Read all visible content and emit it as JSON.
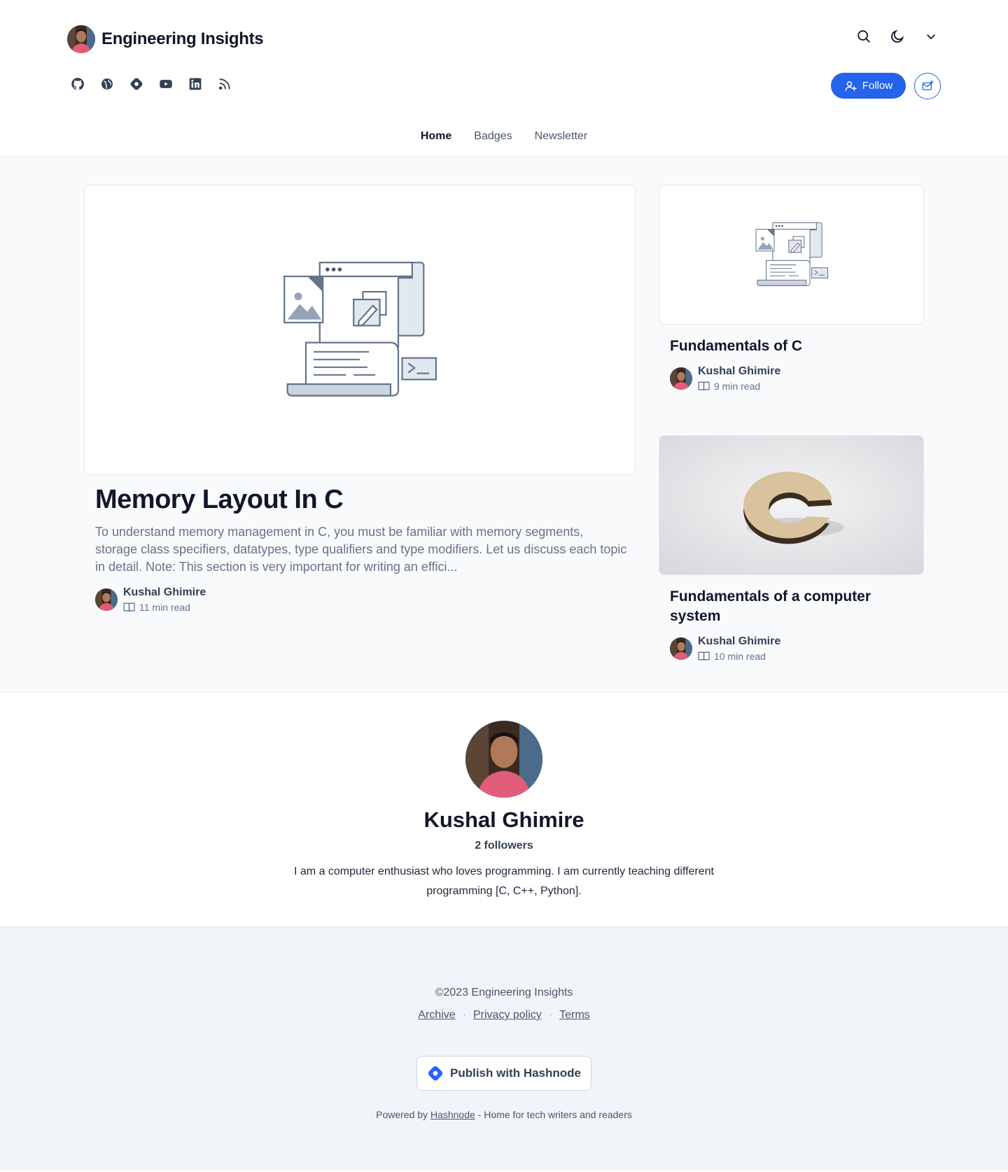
{
  "header": {
    "blog_title": "Engineering Insights",
    "follow_label": "Follow",
    "brand_color": "#2563eb",
    "tools": [
      "search-icon",
      "moon-icon",
      "chevron-down-icon"
    ],
    "socials": [
      "github-icon",
      "globe-icon",
      "hashnode-icon",
      "youtube-icon",
      "linkedin-icon",
      "rss-icon"
    ]
  },
  "nav": {
    "items": [
      {
        "label": "Home",
        "active": true
      },
      {
        "label": "Badges",
        "active": false
      },
      {
        "label": "Newsletter",
        "active": false
      }
    ]
  },
  "featured": {
    "title": "Memory Layout In C",
    "brief": "To understand memory management in C, you must be familiar with memory segments, storage class specifiers, datatypes, type qualifiers and type modifiers. Let us discuss each topic in detail. Note: This section is very important for writing an effici...",
    "author": "Kushal Ghimire",
    "read_time": "11 min read"
  },
  "side_posts": [
    {
      "title": "Fundamentals of C",
      "author": "Kushal Ghimire",
      "read_time": "9 min read"
    },
    {
      "title": "Fundamentals of a computer system",
      "author": "Kushal Ghimire",
      "read_time": "10 min read"
    }
  ],
  "author_card": {
    "name": "Kushal Ghimire",
    "followers": "2 followers",
    "bio": "I am a computer enthusiast who loves programming. I am currently teaching different programming [C, C++, Python]."
  },
  "footer": {
    "copyright": "©2023 Engineering Insights",
    "links": [
      "Archive",
      "Privacy policy",
      "Terms"
    ],
    "separator": "·",
    "publish_label": "Publish with Hashnode",
    "powered_prefix": "Powered by",
    "powered_link": "Hashnode",
    "powered_suffix": "- Home for tech writers and readers"
  }
}
